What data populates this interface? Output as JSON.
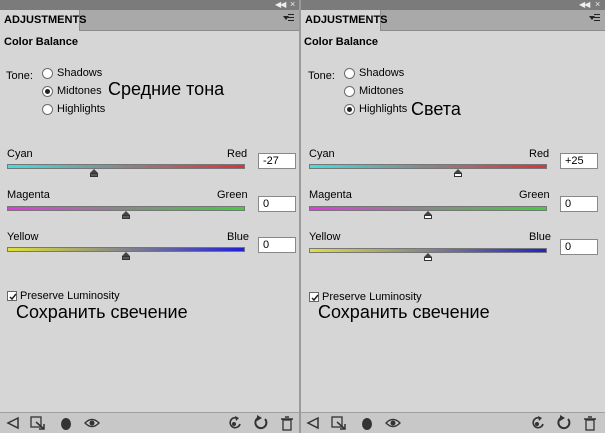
{
  "panels": [
    {
      "tab": "ADJUSTMENTS",
      "title": "Color Balance",
      "tone_label": "Tone:",
      "tones": [
        "Shadows",
        "Midtones",
        "Highlights"
      ],
      "selected_tone": "Midtones",
      "annotation": "Средние тона",
      "sliders": [
        {
          "left": "Cyan",
          "right": "Red",
          "value": "-27",
          "level": -27
        },
        {
          "left": "Magenta",
          "right": "Green",
          "value": "0",
          "level": 0
        },
        {
          "left": "Yellow",
          "right": "Blue",
          "value": "0",
          "level": 0
        }
      ],
      "preserve_label": "Preserve Luminosity",
      "preserve_checked": true,
      "preserve_annotation": "Сохранить свечение"
    },
    {
      "tab": "ADJUSTMENTS",
      "title": "Color Balance",
      "tone_label": "Tone:",
      "tones": [
        "Shadows",
        "Midtones",
        "Highlights"
      ],
      "selected_tone": "Highlights",
      "annotation": "Света",
      "sliders": [
        {
          "left": "Cyan",
          "right": "Red",
          "value": "+25",
          "level": 25
        },
        {
          "left": "Magenta",
          "right": "Green",
          "value": "0",
          "level": 0
        },
        {
          "left": "Yellow",
          "right": "Blue",
          "value": "0",
          "level": 0
        }
      ],
      "preserve_label": "Preserve Luminosity",
      "preserve_checked": true,
      "preserve_annotation": "Сохранить свечение"
    }
  ],
  "bottom_icons": [
    "return-icon",
    "clip-layer-icon",
    "mask-visibility-icon",
    "eye-icon",
    "reset-view-icon",
    "reset-icon",
    "trash-icon"
  ]
}
